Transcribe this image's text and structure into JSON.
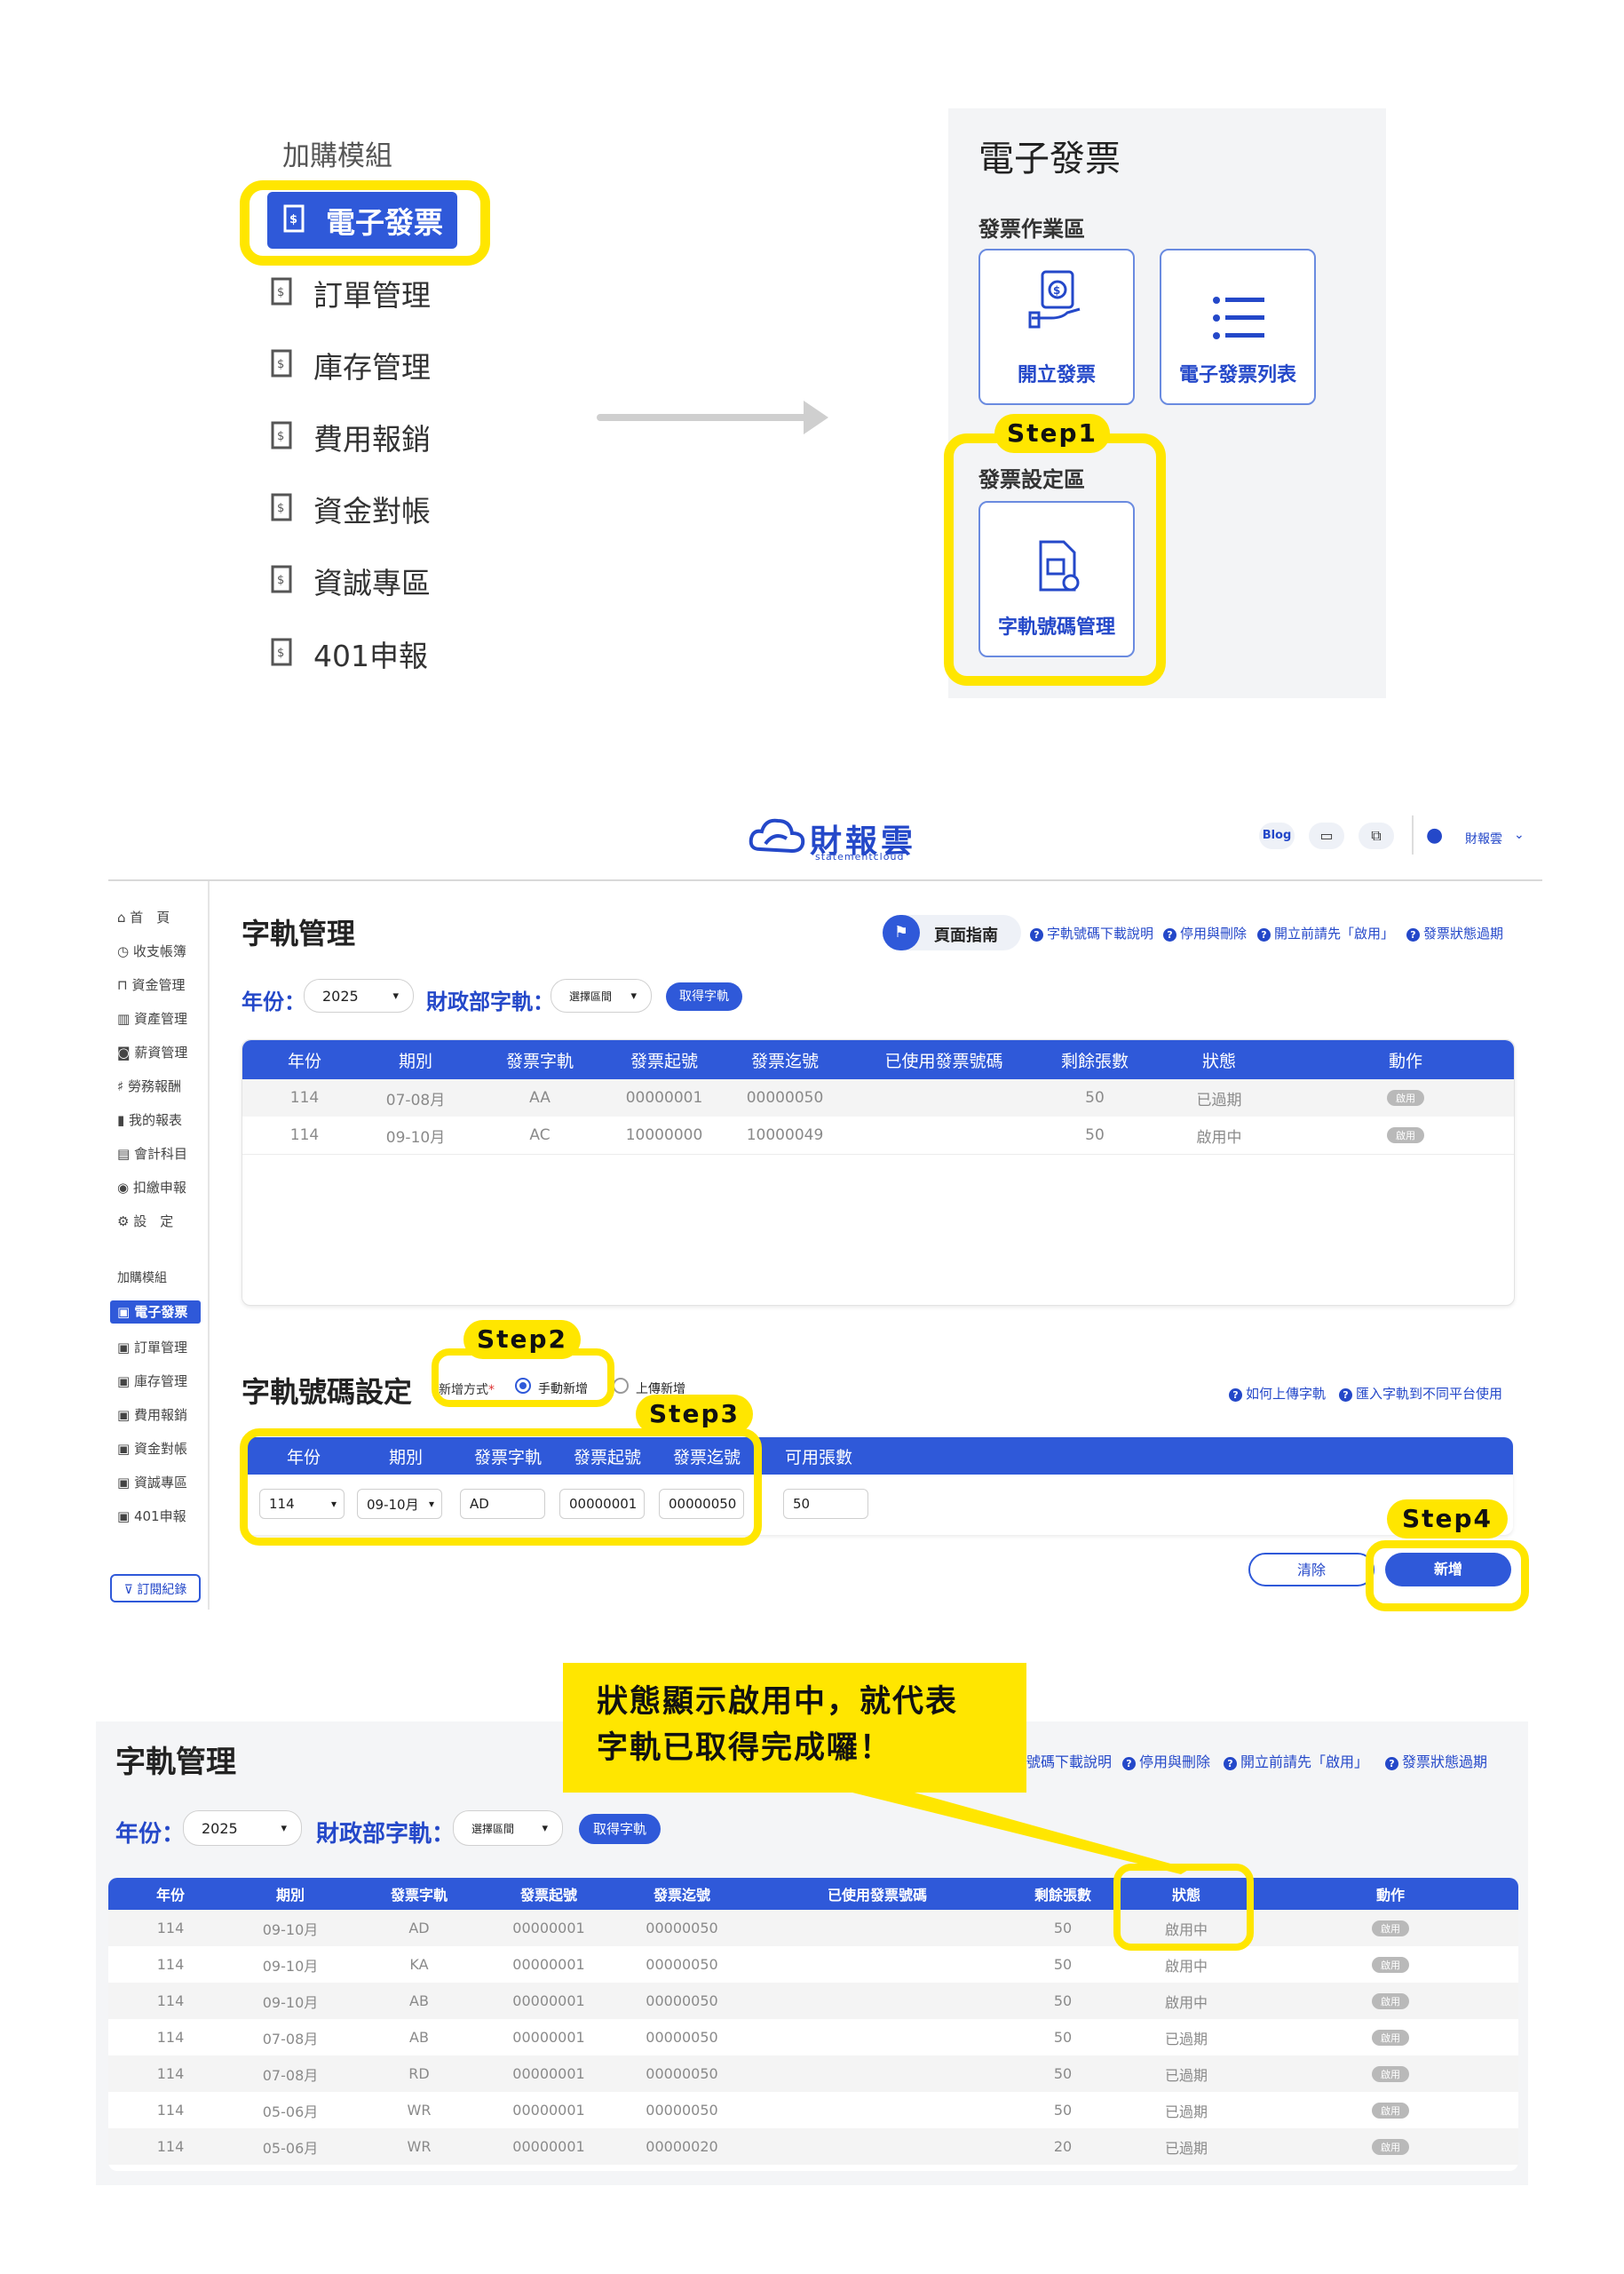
{
  "addon_menu": {
    "title": "加購模組",
    "items": [
      {
        "label": "電子發票",
        "active": true
      },
      {
        "label": "訂單管理"
      },
      {
        "label": "庫存管理"
      },
      {
        "label": "費用報銷"
      },
      {
        "label": "資金對帳"
      },
      {
        "label": "資誠專區"
      },
      {
        "label": "401申報"
      }
    ]
  },
  "einvoice_panel": {
    "title": "電子發票",
    "work_area": "發票作業區",
    "cards": {
      "issue": "開立發票",
      "list": "電子發票列表",
      "track": "字軌號碼管理"
    },
    "settings_area": "發票設定區"
  },
  "steps": {
    "s1": "Step1",
    "s2": "Step2",
    "s3": "Step3",
    "s4": "Step4"
  },
  "app": {
    "brand": "財報雲",
    "brand_sub": "statementcloud",
    "header": {
      "blog": "Blog",
      "user": "財報雲"
    },
    "sidebar": {
      "items": [
        "首　頁",
        "收支帳簿",
        "資金管理",
        "資產管理",
        "薪資管理",
        "勞務報酬",
        "我的報表",
        "會計科目",
        "扣繳申報",
        "設　定"
      ],
      "addon_title": "加購模組",
      "addon_items": [
        "電子發票",
        "訂單管理",
        "庫存管理",
        "費用報銷",
        "資金對帳",
        "資誠專區",
        "401申報"
      ],
      "subscribe": "訂閱紀錄"
    },
    "page_title": "字軌管理",
    "guide_btn": "頁面指南",
    "help_links": [
      "字軌號碼下載說明",
      "停用與刪除",
      "開立前請先「啟用」",
      "發票狀態過期"
    ],
    "filter": {
      "year_label": "年份：",
      "year_value": "2025",
      "mof_label": "財政部字軌：",
      "mof_value": "選擇區間",
      "get_btn": "取得字軌"
    },
    "table_headers": [
      "年份",
      "期別",
      "發票字軌",
      "發票起號",
      "發票迄號",
      "已使用發票號碼",
      "剩餘張數",
      "狀態",
      "動作"
    ],
    "table_rows": [
      [
        "114",
        "07-08月",
        "AA",
        "00000001",
        "00000050",
        "",
        "50",
        "已過期",
        "啟用"
      ],
      [
        "114",
        "09-10月",
        "AC",
        "10000000",
        "10000049",
        "",
        "50",
        "啟用中",
        "啟用"
      ]
    ],
    "settings": {
      "title": "字軌號碼設定",
      "method_label": "新增方式",
      "method_required": "*",
      "opt_manual": "手動新增",
      "opt_upload": "上傳新增",
      "help_links": [
        "如何上傳字軌",
        "匯入字軌到不同平台使用"
      ],
      "headers": [
        "年份",
        "期別",
        "發票字軌",
        "發票起號",
        "發票迄號",
        "可用張數"
      ],
      "values": {
        "year": "114",
        "period": "09-10月",
        "track": "AD",
        "start": "00000001",
        "end": "00000050",
        "count": "50"
      },
      "clear_btn": "清除",
      "add_btn": "新增"
    }
  },
  "result": {
    "page_title": "字軌管理",
    "help_partial": "號碼下載說明",
    "help_links": [
      "停用與刪除",
      "開立前請先「啟用」",
      "發票狀態過期"
    ],
    "filter": {
      "year_label": "年份：",
      "year_value": "2025",
      "mof_label": "財政部字軌：",
      "mof_value": "選擇區間",
      "get_btn": "取得字軌"
    },
    "callout_line1": "狀態顯示啟用中，就代表",
    "callout_line2": "字軌已取得完成囉！",
    "table_headers": [
      "年份",
      "期別",
      "發票字軌",
      "發票起號",
      "發票迄號",
      "已使用發票號碼",
      "剩餘張數",
      "狀態",
      "動作"
    ],
    "table_rows": [
      [
        "114",
        "09-10月",
        "AD",
        "00000001",
        "00000050",
        "",
        "50",
        "啟用中",
        "啟用"
      ],
      [
        "114",
        "09-10月",
        "KA",
        "00000001",
        "00000050",
        "",
        "50",
        "啟用中",
        "啟用"
      ],
      [
        "114",
        "09-10月",
        "AB",
        "00000001",
        "00000050",
        "",
        "50",
        "啟用中",
        "啟用"
      ],
      [
        "114",
        "07-08月",
        "AB",
        "00000001",
        "00000050",
        "",
        "50",
        "已過期",
        "啟用"
      ],
      [
        "114",
        "07-08月",
        "RD",
        "00000001",
        "00000050",
        "",
        "50",
        "已過期",
        "啟用"
      ],
      [
        "114",
        "05-06月",
        "WR",
        "00000001",
        "00000050",
        "",
        "50",
        "已過期",
        "啟用"
      ],
      [
        "114",
        "05-06月",
        "WR",
        "00000001",
        "00000020",
        "",
        "20",
        "已過期",
        "啟用"
      ]
    ]
  },
  "colors": {
    "brand_blue": "#2f59d9",
    "highlight": "#ffe600"
  }
}
